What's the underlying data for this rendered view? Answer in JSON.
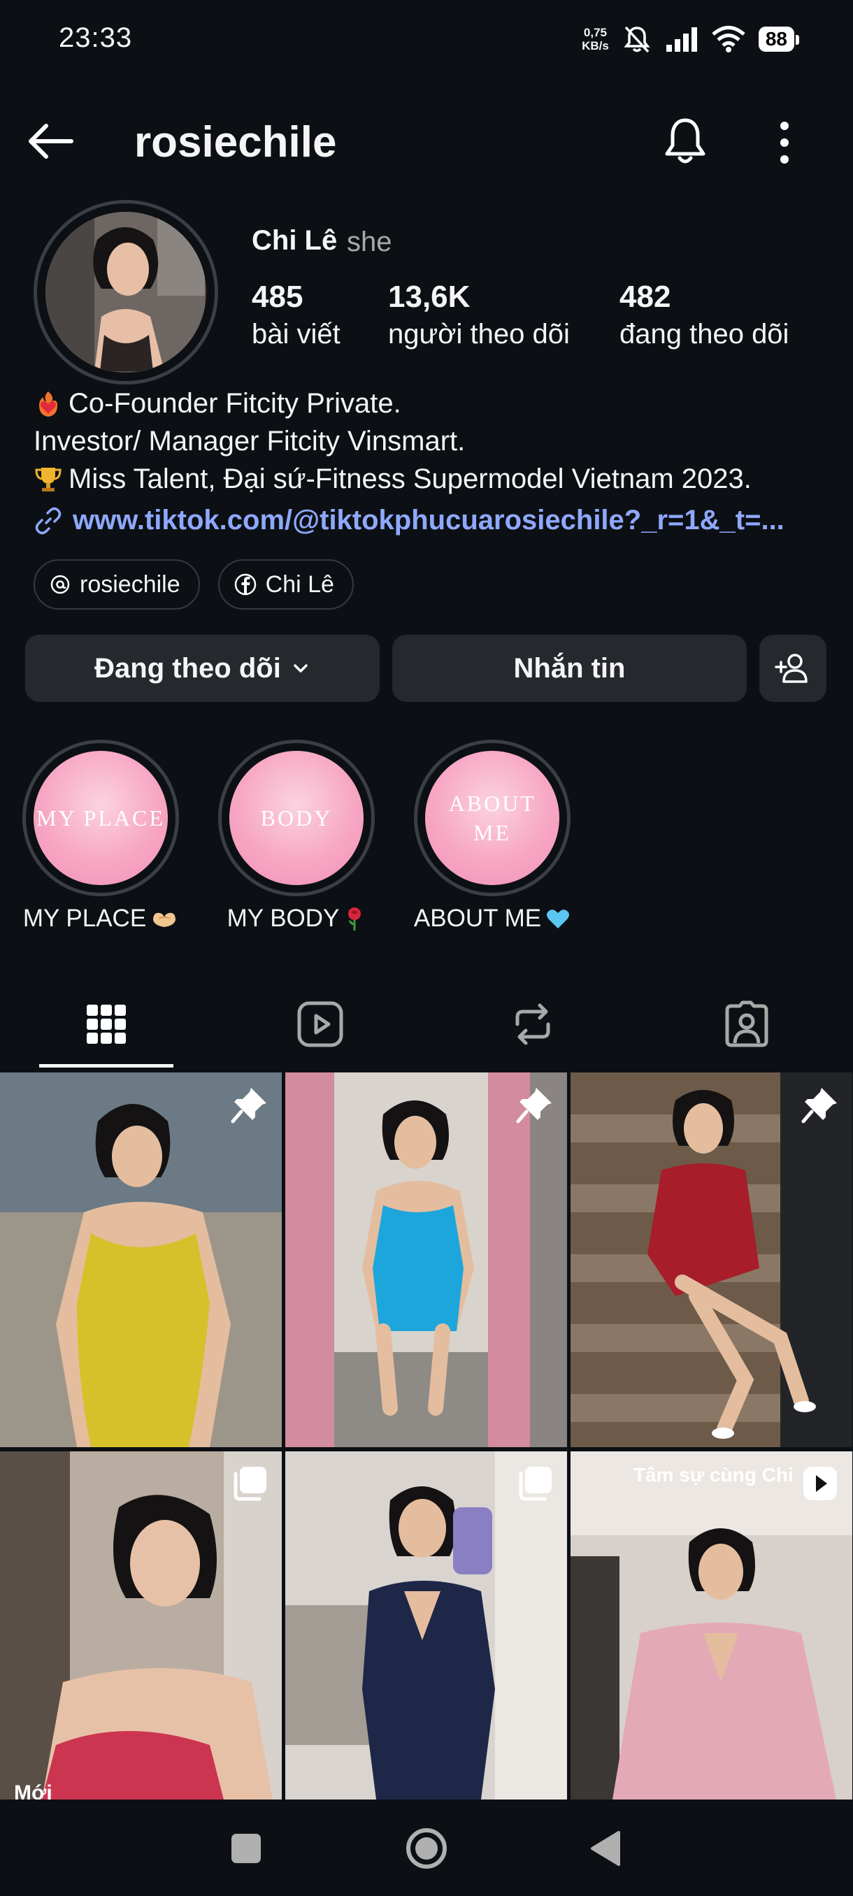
{
  "status_bar": {
    "time": "23:33",
    "speed_value": "0,75",
    "speed_unit": "KB/s",
    "battery": "88"
  },
  "header": {
    "username": "rosiechile"
  },
  "profile": {
    "display_name": "Chi Lê",
    "pronoun": "she",
    "stats": {
      "posts": {
        "value": "485",
        "label": "bài viết"
      },
      "followers": {
        "value": "13,6K",
        "label": "người theo dõi"
      },
      "following": {
        "value": "482",
        "label": "đang theo dõi"
      }
    },
    "bio": [
      "Co-Founder Fitcity Private.",
      "Investor/ Manager Fitcity Vinsmart.",
      "Miss Talent, Đại sứ-Fitness Supermodel Vietnam 2023."
    ],
    "link": "www.tiktok.com/@tiktokphucuarosiechile?_r=1&_t=...",
    "threads": "rosiechile",
    "facebook": "Chi Lê"
  },
  "actions": {
    "following": "Đang theo dõi",
    "message": "Nhắn tin"
  },
  "highlights": [
    {
      "cover": "MY PLACE",
      "label": "MY PLACE"
    },
    {
      "cover": "BODY",
      "label": "MY BODY"
    },
    {
      "cover": "ABOUT ME",
      "label": "ABOUT ME"
    }
  ],
  "tabs": [
    "grid-icon",
    "reels-icon",
    "reposts-icon",
    "tagged-icon"
  ],
  "posts": [
    {
      "badge": "pin-icon"
    },
    {
      "badge": "pin-icon"
    },
    {
      "badge": "pin-icon"
    },
    {
      "badge": "carousel-icon",
      "bottom_text": "Mới"
    },
    {
      "badge": "carousel-icon"
    },
    {
      "badge": "reel-icon",
      "caption": "Tâm sự cùng Chi"
    }
  ],
  "colors": {
    "background": "#0c1014",
    "button": "#25292e",
    "link": "#8fa8ff",
    "highlight_pink": "#f7a7c3"
  }
}
